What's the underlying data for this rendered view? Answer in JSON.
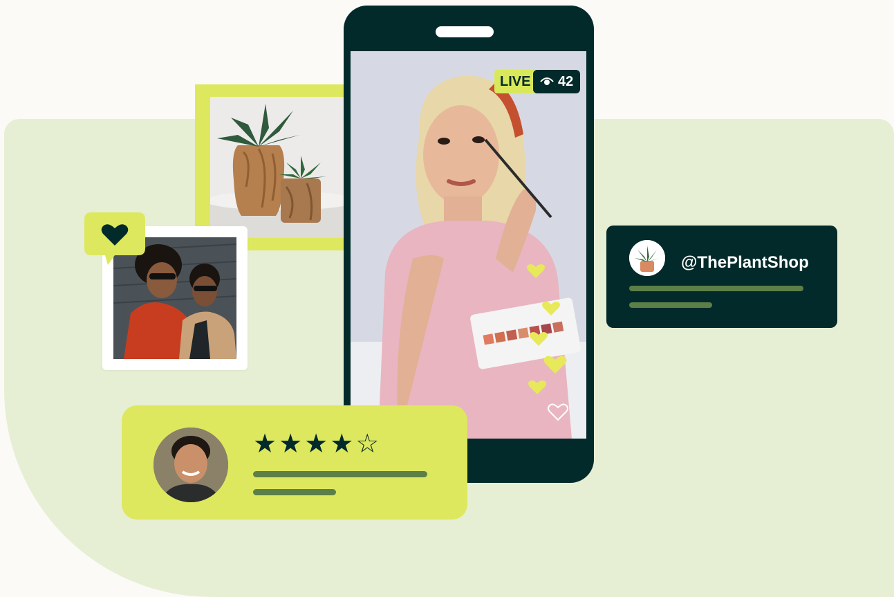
{
  "live_stream": {
    "live_label": "LIVE",
    "viewer_count": "42"
  },
  "review": {
    "rating": 4,
    "rating_max": 5,
    "stars_text": "★★★★☆"
  },
  "shop": {
    "handle": "@ThePlantShop"
  },
  "colors": {
    "dark_green": "#032a2a",
    "lime": "#dde85f",
    "pale_green": "#e6efd4",
    "line_green": "#5c7f48",
    "heart_yellow": "#e7e95a"
  },
  "icons": [
    "eye-icon",
    "heart-icon",
    "heart-outline-icon",
    "star-icon"
  ]
}
